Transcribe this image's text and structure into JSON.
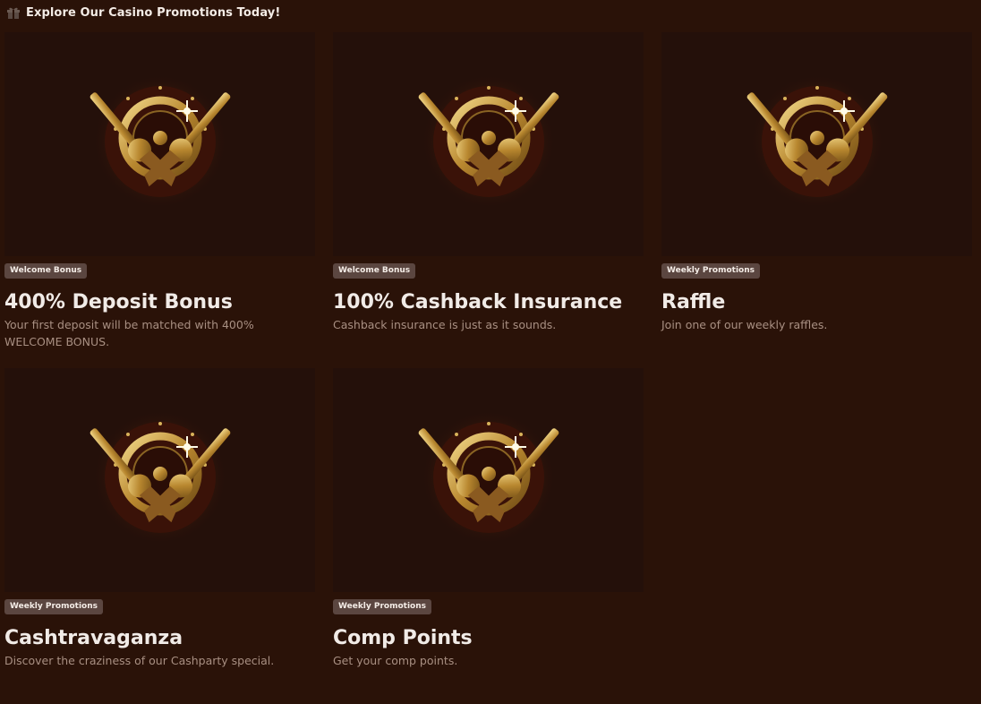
{
  "header": {
    "icon": "gift-icon",
    "title": "Explore Our Casino Promotions Today!"
  },
  "promotions": [
    {
      "badge": "Welcome Bonus",
      "title": "400% Deposit Bonus",
      "description": "Your first deposit will be matched with 400% WELCOME BONUS."
    },
    {
      "badge": "Welcome Bonus",
      "title": "100% Cashback Insurance",
      "description": "Cashback insurance is just as it sounds."
    },
    {
      "badge": "Weekly Promotions",
      "title": "Raffle",
      "description": "Join one of our weekly raffles."
    },
    {
      "badge": "Weekly Promotions",
      "title": "Cashtravaganza",
      "description": "Discover the craziness of our Cashparty special."
    },
    {
      "badge": "Weekly Promotions",
      "title": "Comp Points",
      "description": "Get your comp points."
    }
  ],
  "colors": {
    "background": "#2a1208",
    "card_image_bg": "#24100a",
    "badge_bg": "#5b4640",
    "gold": "#c9a24a"
  }
}
